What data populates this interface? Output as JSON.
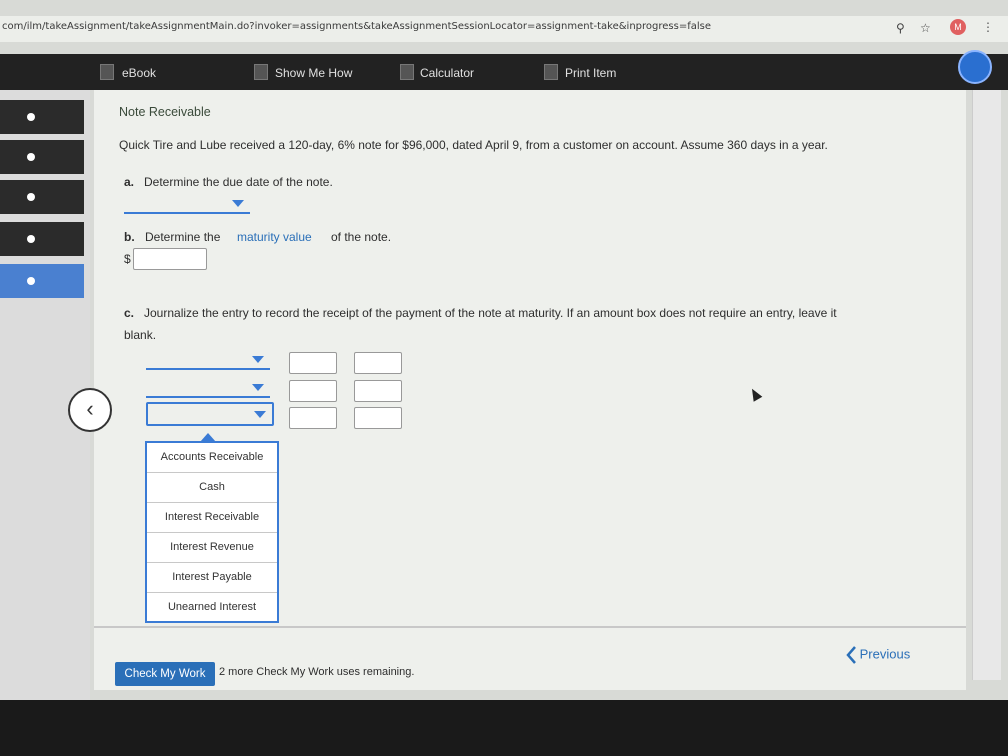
{
  "browser": {
    "url": "com/ilm/takeAssignment/takeAssignmentMain.do?invoker=assignments&takeAssignmentSessionLocator=assignment-take&inprogress=false",
    "avatar_letter": "M"
  },
  "toolbar": {
    "ebook": "eBook",
    "show_me_how": "Show Me How",
    "calculator": "Calculator",
    "print_item": "Print Item"
  },
  "problem": {
    "title": "Note Receivable",
    "statement": "Quick Tire and Lube received a 120-day, 6% note for $96,000, dated April 9, from a customer on account. Assume 360 days in a year.",
    "part_a": {
      "label": "a.",
      "text": "Determine the due date of the note."
    },
    "part_b": {
      "label": "b.",
      "text_before": "Determine the",
      "link": "maturity value",
      "text_after": "of the note.",
      "currency": "$"
    },
    "part_c": {
      "label": "c.",
      "text_line1": "Journalize the entry to record the receipt of the payment of the note at maturity. If an amount box does not require an entry, leave it",
      "text_line2": "blank."
    }
  },
  "account_options": [
    "Accounts Receivable",
    "Cash",
    "Interest Receivable",
    "Interest Revenue",
    "Interest Payable",
    "Unearned Interest"
  ],
  "footer": {
    "check_button": "Check My Work",
    "remaining": "2 more Check My Work uses remaining.",
    "previous": "Previous"
  },
  "colors": {
    "accent": "#2a6fb8",
    "toolbar_bg": "#222222"
  }
}
